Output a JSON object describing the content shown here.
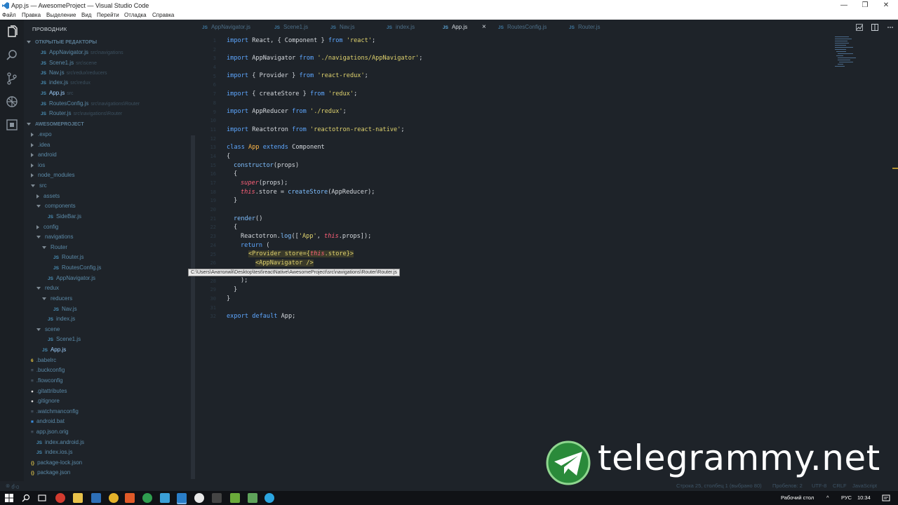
{
  "window": {
    "title": "App.js — AwesomeProject — Visual Studio Code",
    "minimize": "—",
    "maximize": "❐",
    "close": "✕"
  },
  "menu": [
    "Файл",
    "Правка",
    "Выделение",
    "Вид",
    "Перейти",
    "Отладка",
    "Справка"
  ],
  "sidebar": {
    "header": "ПРОВОДНИК",
    "open_editors_label": "ОТКРЫТЫЕ РЕДАКТОРЫ",
    "open_editors": [
      {
        "name": "AppNavigator.js",
        "path": "src\\navigations"
      },
      {
        "name": "Scene1.js",
        "path": "src\\scene"
      },
      {
        "name": "Nav.js",
        "path": "src\\redux\\reducers"
      },
      {
        "name": "index.js",
        "path": "src\\redux"
      },
      {
        "name": "App.js",
        "path": "src"
      },
      {
        "name": "RoutesConfig.js",
        "path": "src\\navigations\\Router"
      },
      {
        "name": "Router.js",
        "path": "src\\navigations\\Router"
      }
    ],
    "project_label": "AWESOMEPROJECT",
    "tree": [
      {
        "name": ".expo",
        "type": "folder-closed"
      },
      {
        "name": ".idea",
        "type": "folder-closed"
      },
      {
        "name": "android",
        "type": "folder-closed"
      },
      {
        "name": "ios",
        "type": "folder-closed"
      },
      {
        "name": "node_modules",
        "type": "folder-closed"
      },
      {
        "name": "src",
        "type": "folder-open"
      },
      {
        "name": "assets",
        "type": "folder-closed"
      },
      {
        "name": "components",
        "type": "folder-open"
      },
      {
        "name": "SideBar.js",
        "type": "js"
      },
      {
        "name": "config",
        "type": "folder-closed"
      },
      {
        "name": "navigations",
        "type": "folder-open"
      },
      {
        "name": "Router",
        "type": "folder-open"
      },
      {
        "name": "Router.js",
        "type": "js"
      },
      {
        "name": "RoutesConfig.js",
        "type": "js"
      },
      {
        "name": "AppNavigator.js",
        "type": "js"
      },
      {
        "name": "redux",
        "type": "folder-open"
      },
      {
        "name": "reducers",
        "type": "folder-open"
      },
      {
        "name": "Nav.js",
        "type": "js"
      },
      {
        "name": "index.js",
        "type": "js"
      },
      {
        "name": "scene",
        "type": "folder-open"
      },
      {
        "name": "Scene1.js",
        "type": "js"
      },
      {
        "name": "App.js",
        "type": "js"
      },
      {
        "name": ".babelrc",
        "type": "file"
      },
      {
        "name": ".buckconfig",
        "type": "file"
      },
      {
        "name": ".flowconfig",
        "type": "file"
      },
      {
        "name": ".gitattributes",
        "type": "git"
      },
      {
        "name": ".gitignore",
        "type": "git"
      },
      {
        "name": ".watchmanconfig",
        "type": "file"
      },
      {
        "name": "android.bat",
        "type": "win"
      },
      {
        "name": "app.json.orig",
        "type": "file"
      },
      {
        "name": "index.android.js",
        "type": "js"
      },
      {
        "name": "index.ios.js",
        "type": "js"
      },
      {
        "name": "package-lock.json",
        "type": "json"
      },
      {
        "name": "package.json",
        "type": "json"
      }
    ]
  },
  "tabs": [
    {
      "label": "AppNavigator.js"
    },
    {
      "label": "Scene1.js"
    },
    {
      "label": "Nav.js"
    },
    {
      "label": "index.js"
    },
    {
      "label": "App.js"
    },
    {
      "label": "RoutesConfig.js"
    },
    {
      "label": "Router.js"
    }
  ],
  "tab_close": "×",
  "editor": {
    "line_numbers": [
      "1",
      "2",
      "3",
      "4",
      "5",
      "6",
      "7",
      "8",
      "9",
      "10",
      "11",
      "12",
      "13",
      "14",
      "15",
      "16",
      "17",
      "18",
      "19",
      "20",
      "21",
      "22",
      "23",
      "24",
      "25",
      "26",
      "27",
      "28",
      "29",
      "30",
      "31",
      "32"
    ],
    "tokens": {
      "import": "import",
      "from": "from",
      "class": "class",
      "extends": "extends",
      "return": "return",
      "export_default": "export default",
      "this": "this",
      "super": "super",
      "l1_mid": " React, { Component } ",
      "l1_str": "'react'",
      "l3_mid": " AppNavigator ",
      "l3_str": "'./navigations/AppNavigator'",
      "l5_mid": " { Provider } ",
      "l5_str": "'react-redux'",
      "l7_mid": " { createStore } ",
      "l7_str": "'redux'",
      "l9_mid": " AppReducer ",
      "l9_str": "'./redux'",
      "l11_mid": " Reactotron ",
      "l11_str": "'reactotron-react-native'",
      "app": " App ",
      "component": "Component",
      "open_brace": "{",
      "close_brace": "}",
      "constructor": "constructor",
      "props_paren": "(props)",
      "l17_rest": "(props);",
      "store_assign": ".store = ",
      "createStore": "createStore",
      "appreducer_call": "(AppReducer);",
      "render": "render",
      "paren": "()",
      "reactotron_log": "Reactotron.",
      "log": "log",
      "log_open": "([",
      "app_str": "'App'",
      "comma": ", ",
      "props_tail": ".props]);",
      "return_open": " (",
      "provider_open": "<Provider store={",
      "store_tail": ".store}>",
      "appnavigator": "<AppNavigator />",
      "close_paren": ");",
      "export_tail": " App;",
      "semi": ";"
    }
  },
  "tooltip": "C:\\Users\\Анатолий\\Desktop\\test\\reactNative\\AwesomeProject\\src\\navigations\\Router\\Router.js",
  "statusbar": {
    "errors": "0",
    "warnings": "0",
    "position": "Строка 25, столбец 1 (выбрано 80)",
    "spaces": "Пробелов: 2",
    "encoding": "UTF-8",
    "eol": "CRLF",
    "language": "JavaScript"
  },
  "taskbar": {
    "desktop_label": "Рабочий стол",
    "lang": "РУС",
    "time": "10:34"
  },
  "watermark": {
    "text": "telegrammy.net"
  },
  "colors": {
    "background": "#1e2329",
    "keyword": "#5ea7ff",
    "string": "#e0d36e",
    "class": "#ffb84a",
    "this": "#ff6079"
  }
}
